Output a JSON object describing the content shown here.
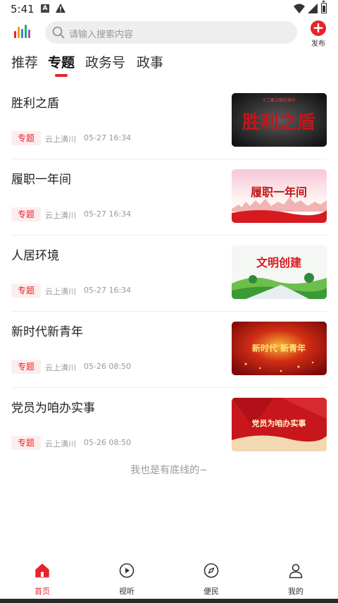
{
  "status_bar": {
    "time": "5:41"
  },
  "search": {
    "placeholder": "请输入搜索内容"
  },
  "publish": {
    "label": "发布"
  },
  "tabs": [
    {
      "label": "推荐"
    },
    {
      "label": "专题"
    },
    {
      "label": "政务号"
    },
    {
      "label": "政事"
    }
  ],
  "articles": [
    {
      "title": "胜利之盾",
      "tag": "专题",
      "source": "云上潢川",
      "time": "05-27 16:34",
      "thumb_text": "胜利之盾",
      "thumb_sub": "十二集文献纪录片"
    },
    {
      "title": "履职一年间",
      "tag": "专题",
      "source": "云上潢川",
      "time": "05-27 16:34",
      "thumb_text": "履职一年间"
    },
    {
      "title": "人居环境",
      "tag": "专题",
      "source": "云上潢川",
      "time": "05-27 16:34",
      "thumb_text": "文明创建"
    },
    {
      "title": "新时代新青年",
      "tag": "专题",
      "source": "云上潢川",
      "time": "05-26 08:50",
      "thumb_text": "新时代 新青年"
    },
    {
      "title": "党员为咱办实事",
      "tag": "专题",
      "source": "云上潢川",
      "time": "05-26 08:50",
      "thumb_text": "党员为咱办实事"
    }
  ],
  "end_text": "我也是有底线的~",
  "bottom_nav": [
    {
      "label": "首页",
      "icon": "home-icon"
    },
    {
      "label": "视听",
      "icon": "play-icon"
    },
    {
      "label": "便民",
      "icon": "compass-icon"
    },
    {
      "label": "我的",
      "icon": "user-icon"
    }
  ],
  "colors": {
    "accent": "#e8232c",
    "tag_bg": "#fdeeee",
    "meta_text": "#999999"
  }
}
